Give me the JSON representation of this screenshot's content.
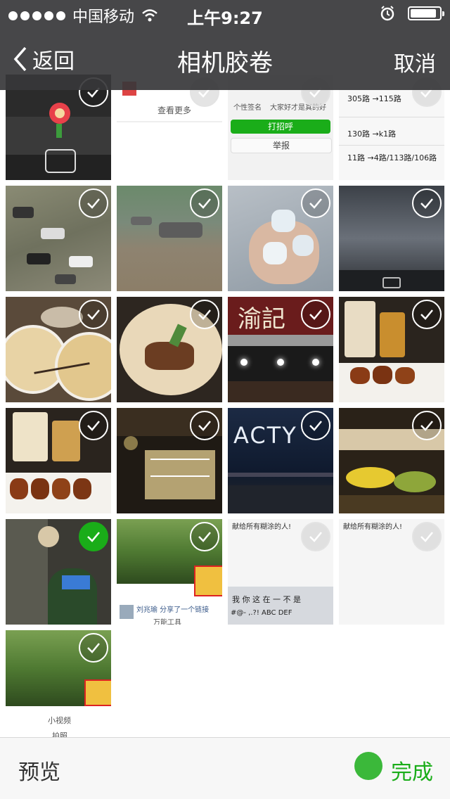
{
  "status_bar": {
    "carrier": "中国移动",
    "time": "上午9:27",
    "battery_level": 0.9
  },
  "nav": {
    "back_label": "返回",
    "title": "相机胶卷",
    "cancel_label": "取消"
  },
  "cells_text": {
    "c2_more": "查看更多",
    "c3_line1": "个性签名",
    "c3_line1b": "大家好才是真的好",
    "c3_call": "打招呼",
    "c3_report": "举报",
    "c4_r1": "305路 →115路",
    "c4_r2": "130路 →k1路",
    "c4_r3": "11路 →4路/113路/106路",
    "c15_line": "献给所有糊涂的人!",
    "c15_keys1": "我  你  这  在  一  不  是",
    "c15_keys2": "#@- ,.?! ABC DEF",
    "c16_line": "献给所有糊涂的人!",
    "c14_share": "刘兆瑜 分享了一个链接",
    "c14_tool": "万能工具",
    "c17_video": "小视频",
    "c17_photo": "拍照",
    "sign_text": "渝記",
    "acty_text": "ACTY"
  },
  "bottom": {
    "preview_label": "预览",
    "done_label": "完成"
  },
  "colors": {
    "accent": "#1aad19",
    "bar_bg": "#37373a"
  }
}
